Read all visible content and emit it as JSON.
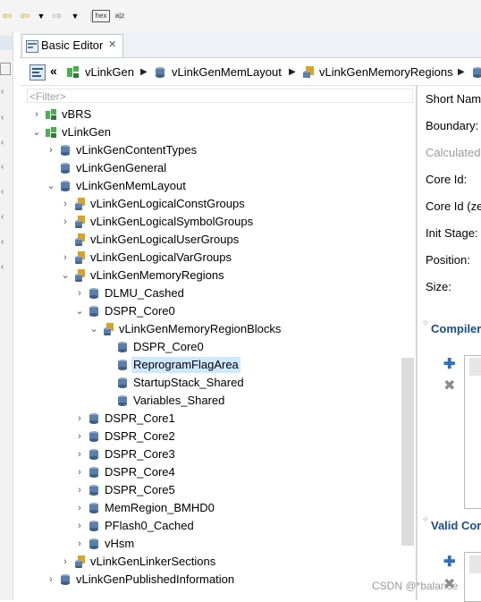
{
  "editor": {
    "tab_label": "Basic Editor",
    "tab_close": "✕"
  },
  "breadcrumb": [
    "vLinkGen",
    "vLinkGenMemLayout",
    "vLinkGenMemoryRegions"
  ],
  "filter_placeholder": "<Filter>",
  "tree": [
    {
      "label": "vBRS",
      "twisty": "›",
      "icon": "module"
    },
    {
      "label": "vLinkGen",
      "twisty": "⌄",
      "icon": "module"
    },
    {
      "label": "vLinkGenContentTypes",
      "twisty": "›",
      "icon": "cyl"
    },
    {
      "label": "vLinkGenGeneral",
      "twisty": "",
      "icon": "cyl"
    },
    {
      "label": "vLinkGenMemLayout",
      "twisty": "⌄",
      "icon": "cyl"
    },
    {
      "label": "vLinkGenLogicalConstGroups",
      "twisty": "›",
      "icon": "group"
    },
    {
      "label": "vLinkGenLogicalSymbolGroups",
      "twisty": "›",
      "icon": "group"
    },
    {
      "label": "vLinkGenLogicalUserGroups",
      "twisty": "",
      "icon": "group"
    },
    {
      "label": "vLinkGenLogicalVarGroups",
      "twisty": "›",
      "icon": "group"
    },
    {
      "label": "vLinkGenMemoryRegions",
      "twisty": "⌄",
      "icon": "group"
    },
    {
      "label": "DLMU_Cashed",
      "twisty": "›",
      "icon": "cyl"
    },
    {
      "label": "DSPR_Core0",
      "twisty": "⌄",
      "icon": "cyl"
    },
    {
      "label": "vLinkGenMemoryRegionBlocks",
      "twisty": "⌄",
      "icon": "group"
    },
    {
      "label": "DSPR_Core0",
      "twisty": "",
      "icon": "cyl"
    },
    {
      "label": "ReprogramFlagArea",
      "twisty": "",
      "icon": "cyl",
      "selected": true
    },
    {
      "label": "StartupStack_Shared",
      "twisty": "",
      "icon": "cyl"
    },
    {
      "label": "Variables_Shared",
      "twisty": "",
      "icon": "cyl"
    },
    {
      "label": "DSPR_Core1",
      "twisty": "›",
      "icon": "cyl"
    },
    {
      "label": "DSPR_Core2",
      "twisty": "›",
      "icon": "cyl"
    },
    {
      "label": "DSPR_Core3",
      "twisty": "›",
      "icon": "cyl"
    },
    {
      "label": "DSPR_Core4",
      "twisty": "›",
      "icon": "cyl"
    },
    {
      "label": "DSPR_Core5",
      "twisty": "›",
      "icon": "cyl"
    },
    {
      "label": "MemRegion_BMHD0",
      "twisty": "›",
      "icon": "cyl"
    },
    {
      "label": "PFlash0_Cached",
      "twisty": "›",
      "icon": "cyl"
    },
    {
      "label": "vHsm",
      "twisty": "›",
      "icon": "cyl"
    },
    {
      "label": "vLinkGenLinkerSections",
      "twisty": "›",
      "icon": "group"
    },
    {
      "label": "vLinkGenPublishedInformation",
      "twisty": "›",
      "icon": "cyl"
    }
  ],
  "properties": [
    "Short Nam",
    "Boundary:",
    "Calculated",
    "Core Id:",
    "Core Id (ze",
    "Init Stage:",
    "Position:",
    "Size:"
  ],
  "sections": {
    "compiler": "Compiler",
    "valid": "Valid Cor"
  },
  "watermark": "CSDN @*balance",
  "colors": {
    "selection": "#cde8ff",
    "section_title": "#1a4e8f",
    "module_icon": "#4caf50",
    "cyl_icon": "#5b7fa8",
    "group_icon": "#e0a020"
  }
}
